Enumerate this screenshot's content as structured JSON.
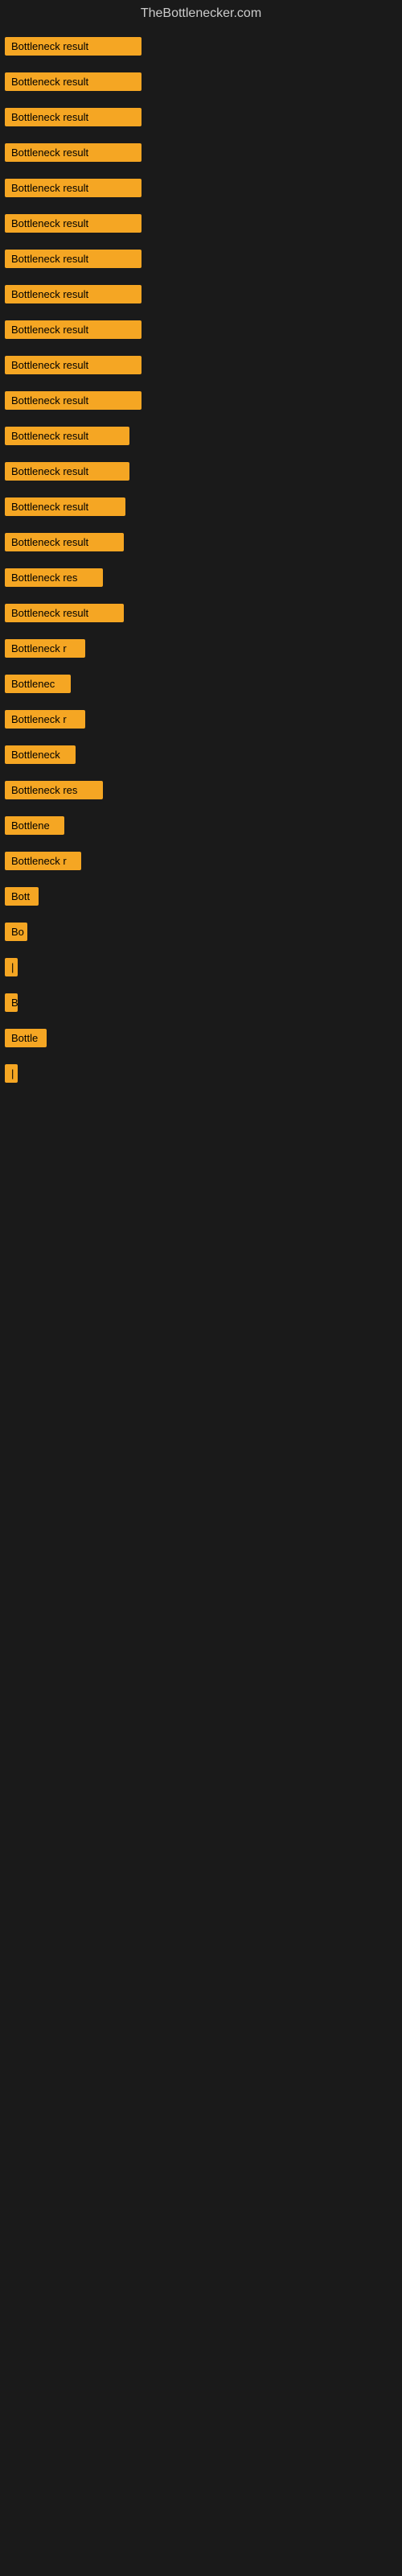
{
  "header": {
    "title": "TheBottlenecker.com"
  },
  "items": [
    {
      "id": 1,
      "label": "Bottleneck result",
      "width": 170
    },
    {
      "id": 2,
      "label": "Bottleneck result",
      "width": 170
    },
    {
      "id": 3,
      "label": "Bottleneck result",
      "width": 170
    },
    {
      "id": 4,
      "label": "Bottleneck result",
      "width": 170
    },
    {
      "id": 5,
      "label": "Bottleneck result",
      "width": 170
    },
    {
      "id": 6,
      "label": "Bottleneck result",
      "width": 170
    },
    {
      "id": 7,
      "label": "Bottleneck result",
      "width": 170
    },
    {
      "id": 8,
      "label": "Bottleneck result",
      "width": 170
    },
    {
      "id": 9,
      "label": "Bottleneck result",
      "width": 170
    },
    {
      "id": 10,
      "label": "Bottleneck result",
      "width": 170
    },
    {
      "id": 11,
      "label": "Bottleneck result",
      "width": 170
    },
    {
      "id": 12,
      "label": "Bottleneck result",
      "width": 155
    },
    {
      "id": 13,
      "label": "Bottleneck result",
      "width": 155
    },
    {
      "id": 14,
      "label": "Bottleneck result",
      "width": 150
    },
    {
      "id": 15,
      "label": "Bottleneck result",
      "width": 148
    },
    {
      "id": 16,
      "label": "Bottleneck res",
      "width": 122
    },
    {
      "id": 17,
      "label": "Bottleneck result",
      "width": 148
    },
    {
      "id": 18,
      "label": "Bottleneck r",
      "width": 100
    },
    {
      "id": 19,
      "label": "Bottlenec",
      "width": 82
    },
    {
      "id": 20,
      "label": "Bottleneck r",
      "width": 100
    },
    {
      "id": 21,
      "label": "Bottleneck",
      "width": 88
    },
    {
      "id": 22,
      "label": "Bottleneck res",
      "width": 122
    },
    {
      "id": 23,
      "label": "Bottlene",
      "width": 74
    },
    {
      "id": 24,
      "label": "Bottleneck r",
      "width": 95
    },
    {
      "id": 25,
      "label": "Bott",
      "width": 42
    },
    {
      "id": 26,
      "label": "Bo",
      "width": 28
    },
    {
      "id": 27,
      "label": "|",
      "width": 10
    },
    {
      "id": 28,
      "label": "B",
      "width": 16
    },
    {
      "id": 29,
      "label": "Bottle",
      "width": 52
    },
    {
      "id": 30,
      "label": "|",
      "width": 10
    }
  ]
}
